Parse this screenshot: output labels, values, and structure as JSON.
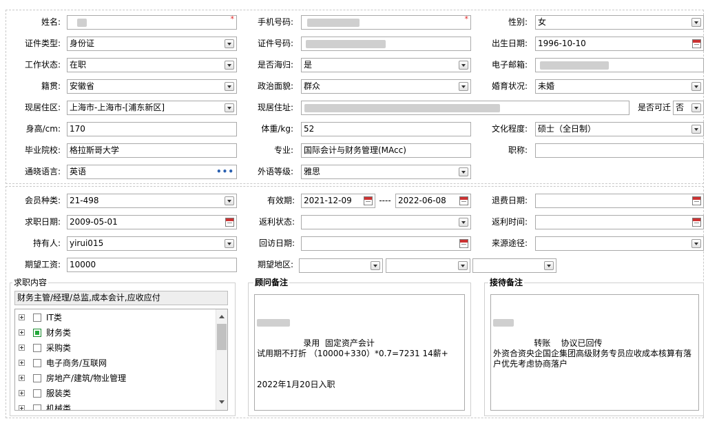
{
  "form": {
    "name": {
      "label": "姓名:",
      "value": "",
      "required": "*"
    },
    "phone": {
      "label": "手机号码:",
      "value": "",
      "required": "*"
    },
    "gender": {
      "label": "性别:",
      "value": "女"
    },
    "id_type": {
      "label": "证件类型:",
      "value": "身份证"
    },
    "id_number": {
      "label": "证件号码:",
      "value": ""
    },
    "birth_date": {
      "label": "出生日期:",
      "value": "1996-10-10"
    },
    "work_status": {
      "label": "工作状态:",
      "value": "在职"
    },
    "returnee": {
      "label": "是否海归:",
      "value": "是"
    },
    "email": {
      "label": "电子邮箱:",
      "value": ""
    },
    "native_place": {
      "label": "籍贯:",
      "value": "安徽省"
    },
    "political_status": {
      "label": "政治面貌:",
      "value": "群众"
    },
    "marital_status": {
      "label": "婚育状况:",
      "value": "未婚"
    },
    "residence_area": {
      "label": "现居住区:",
      "value": "上海市-上海市-[浦东新区]"
    },
    "address": {
      "label": "现居住址:",
      "value": ""
    },
    "relocatable": {
      "label": "是否可迁",
      "value": "否"
    },
    "height": {
      "label": "身高/cm:",
      "value": "170"
    },
    "weight": {
      "label": "体重/kg:",
      "value": "52"
    },
    "education": {
      "label": "文化程度:",
      "value": "硕士（全日制）"
    },
    "school": {
      "label": "毕业院校:",
      "value": "格拉斯哥大学"
    },
    "major": {
      "label": "专业:",
      "value": "国际会计与财务管理(MAcc)"
    },
    "title": {
      "label": "职称:",
      "value": ""
    },
    "language": {
      "label": "通晓语言:",
      "value": "英语",
      "more": "•••"
    },
    "foreign_level": {
      "label": "外语等级:",
      "value": "雅思"
    }
  },
  "membership": {
    "member_type": {
      "label": "会员种类:",
      "value": "21-498"
    },
    "validity": {
      "label": "有效期:",
      "from": "2021-12-09",
      "sep": "----",
      "to": "2022-06-08"
    },
    "refund_date": {
      "label": "退费日期:",
      "value": ""
    },
    "job_seek_date": {
      "label": "求职日期:",
      "value": "2009-05-01"
    },
    "rebate_status": {
      "label": "返利状态:",
      "value": ""
    },
    "rebate_time": {
      "label": "返利时间:",
      "value": ""
    },
    "holder": {
      "label": "持有人:",
      "value": "yirui015"
    },
    "revisit_date": {
      "label": "回访日期:",
      "value": ""
    },
    "source": {
      "label": "来源途径:",
      "value": ""
    },
    "expected_salary": {
      "label": "期望工资:",
      "value": "10000"
    },
    "expected_region": {
      "label": "期望地区:",
      "values": [
        "",
        "",
        ""
      ]
    }
  },
  "job_content": {
    "title": "求职内容",
    "summary": "财务主管/经理/总监,成本会计,应收应付",
    "categories": [
      {
        "label": "IT类",
        "checked": false
      },
      {
        "label": "财务类",
        "checked": true
      },
      {
        "label": "采购类",
        "checked": false
      },
      {
        "label": "电子商务/互联网",
        "checked": false
      },
      {
        "label": "房地产/建筑/物业管理",
        "checked": false
      },
      {
        "label": "服装类",
        "checked": false
      },
      {
        "label": "机械类",
        "checked": false
      }
    ]
  },
  "consultant_notes": {
    "title": "顾问备注",
    "line1": "录用  固定资产会计",
    "line2": "试用期不打折 （10000+330）*0.7=7231 14薪+",
    "line3": "2022年1月20日入职"
  },
  "reception_notes": {
    "title": "接待备注",
    "line1": "转账    协议已回传",
    "line2": "外资合资央企国企集团高级财务专员应收成本核算有落户优先考虑协商落户"
  },
  "colors": {
    "required": "#e02020",
    "checked_box": "#22a93a",
    "more_link": "#2a60b0",
    "border": "#a9a9a9"
  }
}
